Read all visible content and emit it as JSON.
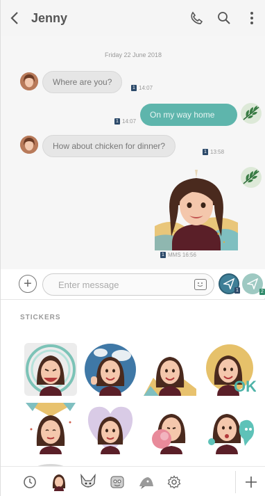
{
  "header": {
    "contact_name": "Jenny",
    "back_icon": "chevron-left-icon",
    "call_icon": "phone-icon",
    "search_icon": "search-icon",
    "more_icon": "more-vertical-icon"
  },
  "chat": {
    "date": "Friday 22 June 2018",
    "messages": [
      {
        "direction": "incoming",
        "text": "Where are you?",
        "sim": "1",
        "time": "14:07"
      },
      {
        "direction": "outgoing",
        "text": "On my way home",
        "sim": "1",
        "time": "14:07"
      },
      {
        "direction": "incoming",
        "text": "How about chicken for dinner?",
        "sim": "1",
        "time": "13:58"
      },
      {
        "direction": "outgoing",
        "type": "sticker",
        "sim": "1",
        "time": "MMS 16:56"
      }
    ]
  },
  "composer": {
    "placeholder": "Enter message",
    "send1_sim": "1",
    "send2_sim": "2"
  },
  "panel": {
    "title": "STICKERS",
    "sticker_count": 8
  },
  "tabs": [
    {
      "name": "recent-icon"
    },
    {
      "name": "avatar-tab"
    },
    {
      "name": "fox-character-icon"
    },
    {
      "name": "cartoon-character-icon"
    },
    {
      "name": "fish-character-icon"
    },
    {
      "name": "settings-icon"
    }
  ],
  "colors": {
    "accent_teal": "#5eb5ac",
    "sim_badge": "#2c4a6a",
    "sim2_badge": "#2f8a6a"
  }
}
